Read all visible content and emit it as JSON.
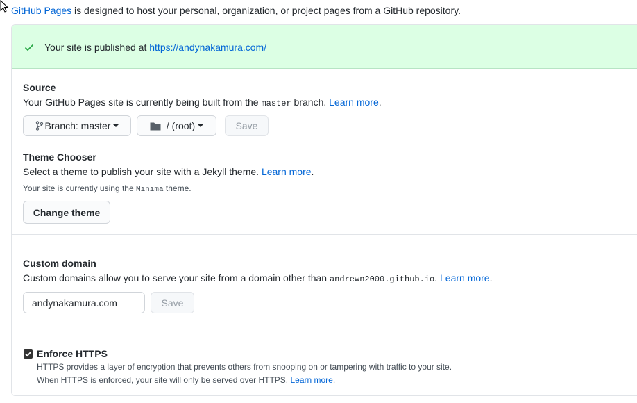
{
  "intro": {
    "link": "GitHub Pages",
    "text": " is designed to host your personal, organization, or project pages from a GitHub repository."
  },
  "flash": {
    "text": "Your site is published at ",
    "url": "https://andynakamura.com/"
  },
  "source": {
    "title": "Source",
    "desc_prefix": "Your GitHub Pages site is currently being built from the ",
    "branch_code": "master",
    "desc_suffix": " branch. ",
    "learn_more": "Learn more",
    "period": ".",
    "branch_button": "Branch: master",
    "folder_button": "/ (root)",
    "save_button": "Save"
  },
  "theme": {
    "title": "Theme Chooser",
    "desc": "Select a theme to publish your site with a Jekyll theme. ",
    "learn_more": "Learn more",
    "period": ".",
    "note_prefix": "Your site is currently using the ",
    "theme_name": "Minima",
    "note_suffix": " theme.",
    "change_button": "Change theme"
  },
  "custom_domain": {
    "title": "Custom domain",
    "desc_prefix": "Custom domains allow you to serve your site from a domain other than ",
    "domain_code": "andrewn2000.github.io",
    "desc_suffix": ". ",
    "learn_more": "Learn more",
    "period": ".",
    "input_value": "andynakamura.com",
    "save_button": "Save"
  },
  "https": {
    "label": "Enforce HTTPS",
    "checked": true,
    "line1": "HTTPS provides a layer of encryption that prevents others from snooping on or tampering with traffic to your site.",
    "line2_prefix": "When HTTPS is enforced, your site will only be served over HTTPS. ",
    "learn_more": "Learn more",
    "period": "."
  }
}
